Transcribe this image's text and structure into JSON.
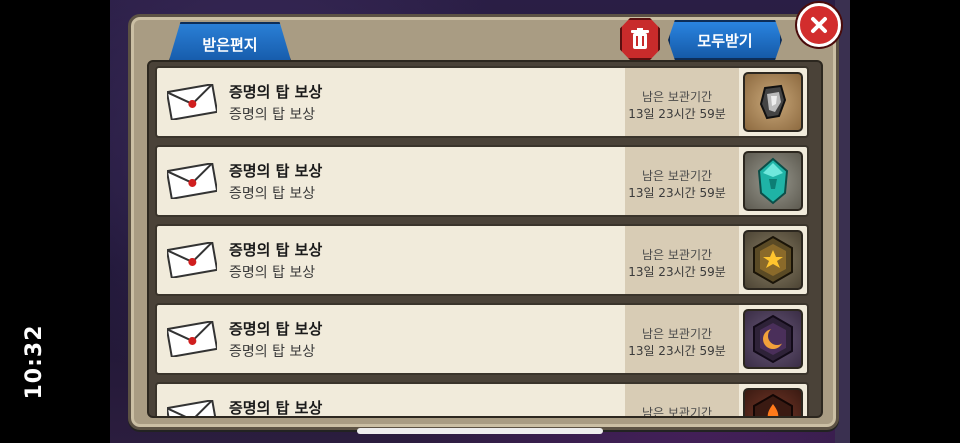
{
  "status_bar": {
    "time": "10:32"
  },
  "mailbox": {
    "tab_label": "받은편지",
    "receive_all_label": "모두받기",
    "keep_label": "남은 보관기간",
    "items": [
      {
        "title": "증명의 탑 보상",
        "subtitle": "증명의 탑 보상",
        "keep_time": "13일 23시간 59분",
        "reward_icon": "armor-fragment-icon"
      },
      {
        "title": "증명의 탑 보상",
        "subtitle": "증명의 탑 보상",
        "keep_time": "13일 23시간 59분",
        "reward_icon": "teal-crystal-icon"
      },
      {
        "title": "증명의 탑 보상",
        "subtitle": "증명의 탑 보상",
        "keep_time": "13일 23시간 59분",
        "reward_icon": "sun-rune-icon"
      },
      {
        "title": "증명의 탑 보상",
        "subtitle": "증명의 탑 보상",
        "keep_time": "13일 23시간 59분",
        "reward_icon": "moon-rune-icon"
      },
      {
        "title": "증명의 탑 보상",
        "subtitle": "",
        "keep_time": "",
        "reward_icon": "fire-rune-icon"
      }
    ]
  },
  "colors": {
    "panel": "#a99c83",
    "row": "#f1ebdb",
    "accent_blue": "#1f6fc6",
    "delete_red": "#c82b2b"
  }
}
